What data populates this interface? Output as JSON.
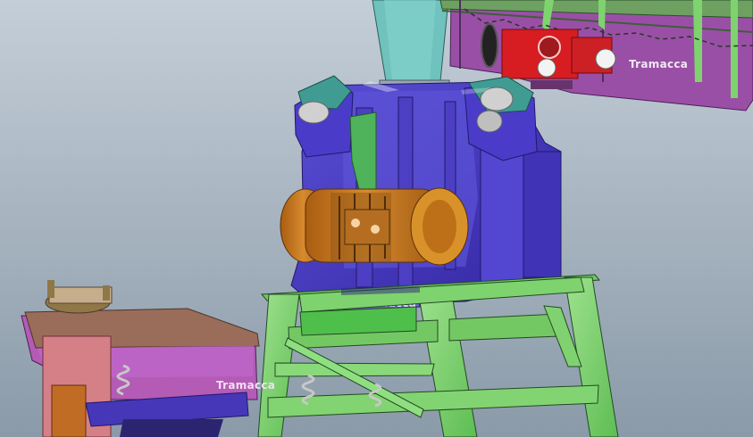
{
  "scene": {
    "logo_motor": "Tramacca",
    "logo_feeder": "Tramacca",
    "logo_screen": "Tramacca"
  },
  "colors": {
    "background_top": "#c4ced8",
    "background_bottom": "#8a9aa8",
    "crusher_blue": "#4637b8",
    "support_green": "#7ed36e",
    "motor_orange": "#c97a19",
    "feeder_purple": "#9a4fa6",
    "hopper_teal": "#6fc2be",
    "motor_red": "#d81d22",
    "screen_magenta": "#b35bb5",
    "spring_gray": "#c8c8c8",
    "column_pink": "#d57f87",
    "panel_olive": "#8f7748"
  },
  "icons": [
    "crusher-icon",
    "motor-icon",
    "feeder-icon",
    "hopper-icon",
    "support-stand-icon"
  ]
}
